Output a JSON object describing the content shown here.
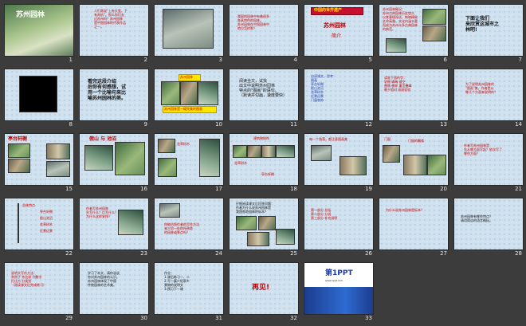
{
  "slides": [
    {
      "n": "1",
      "texts": [
        "苏州园林"
      ]
    },
    {
      "n": "2",
      "texts": [
        "人们常说\"上有天堂，下\n有苏杭\"。那么你们去\n过苏州吗？苏州园林\n是中国园林的代表作品\n之一。"
      ]
    },
    {
      "n": "3",
      "texts": []
    },
    {
      "n": "4",
      "texts": [
        "我国的园林中有着很多\n各具特色的园林。\n苏州园林在中国园林中\n地位怎样呢？"
      ]
    },
    {
      "n": "5",
      "texts": [
        "中国的世界遗产",
        "苏州园林",
        "简介"
      ]
    },
    {
      "n": "6",
      "texts": [
        "苏州园林概况：\n苏州古典园林历史悠久\n以其意境深远、构筑精致\n艺术高雅、文化内涵丰富\n而成为苏州众多古典园林\n的典范。"
      ]
    },
    {
      "n": "7",
      "texts": [
        "下面让我们\n来欣赏这城市之\n林吧!"
      ]
    },
    {
      "n": "8",
      "texts": []
    },
    {
      "n": "9",
      "texts": [
        "看完这段介绍\n后你有何感想，试\n用一个比喻句来比\n喻苏州园林的美。"
      ]
    },
    {
      "n": "10",
      "texts": [
        "苏州园林",
        "苏州园林是一幅完美的图画"
      ]
    },
    {
      "n": "11",
      "texts": [
        "阅读全文，试找\n出文中说明苏州园林\n特点的\"图画\"的语句。\n（默读并勾画，速度要快）"
      ]
    },
    {
      "n": "12",
      "texts": [
        "自读课文，思考：\n图画\n亭台轩榭\n假山池沼\n花草树木\n近景远景\n门窗装饰"
      ]
    },
    {
      "n": "13",
      "texts": [
        "读准下面的字：\n轩榭 嶙峋 镂空\n蔷薇 模样 重峦叠嶂\n朝夕相对 斑斑驳驳"
      ]
    },
    {
      "n": "14",
      "texts": [
        "为了说明苏州园林的\n\"图画\"美，作者是从\n哪几个方面来说明的？"
      ]
    },
    {
      "n": "15",
      "texts": [
        "亭台轩榭"
      ]
    },
    {
      "n": "16",
      "texts": [
        "假山 与 池沼"
      ]
    },
    {
      "n": "17",
      "texts": [
        "花草树木"
      ]
    },
    {
      "n": "18",
      "texts": [
        "建筑物结构",
        "花草树木",
        "亭台轩榭"
      ]
    },
    {
      "n": "19",
      "texts": [
        "每一个角落，都注意图画美"
      ]
    },
    {
      "n": "20",
      "texts": [
        "门窗",
        "门窗的雕镂"
      ]
    },
    {
      "n": "21",
      "texts": [
        "作者写苏州园林是\n先从哪方面写起？依次写了\n哪些方面？"
      ]
    },
    {
      "n": "22",
      "texts": [
        "总体特点",
        "亭台轩榭",
        "假山池沼",
        "花草树木",
        "近景远景"
      ]
    },
    {
      "n": "23",
      "texts": [
        "作者写苏州园林\n先写什么？后写什么？\n为什么这样安排？"
      ]
    },
    {
      "n": "24",
      "texts": [
        "你能仿照作者的写作方法\n来介绍一处你所熟悉\n的园林或景点吗？"
      ]
    },
    {
      "n": "25",
      "texts": [
        "仔细阅读课文后回答问题：\n作者为什么说苏州园林是\n我国各地园林的标本？"
      ]
    },
    {
      "n": "26",
      "texts": [
        "第一部分 总括\n第二部分 分说\n第三部分 补充说明"
      ]
    },
    {
      "n": "27",
      "texts": [
        "为什么说苏州园林是标本？"
      ]
    },
    {
      "n": "28",
      "texts": [
        "苏州园林有哪些特点？\n请用简洁的语言概括。"
      ]
    },
    {
      "n": "29",
      "texts": [
        "说明文写作方法：\n举例子 作比较 列数字\n打比方 分类别\n（阅读课文后完成练习）"
      ]
    },
    {
      "n": "30",
      "texts": [
        "学习了本文，请你谈谈\n你对苏州园林的认识。\n苏州园林体现了中国\n传统园林的艺术美。"
      ]
    },
    {
      "n": "31",
      "texts": [
        "作业：\n1.课后练习一、二\n2.写一篇介绍家乡\n景物的说明文\n3.预习下一课"
      ]
    },
    {
      "n": "32",
      "texts": [
        "再见!"
      ]
    },
    {
      "n": "33",
      "texts": [
        "第1PPT",
        "www.1ppt.com"
      ]
    }
  ]
}
